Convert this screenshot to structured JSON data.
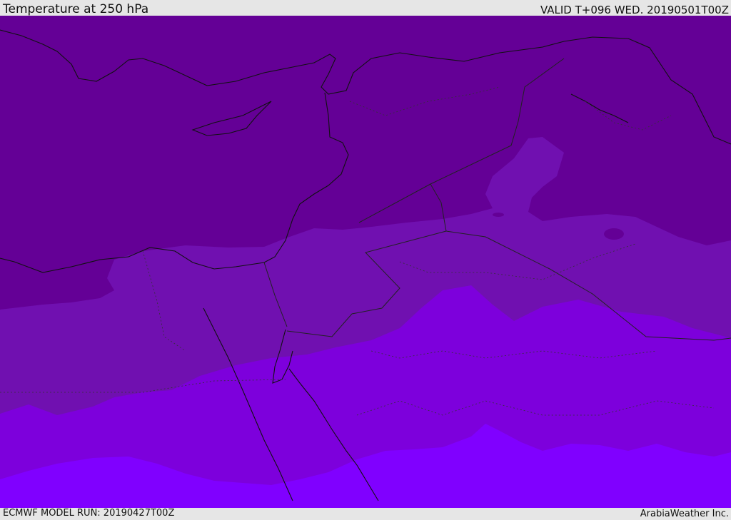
{
  "header": {
    "title": "Temperature at 250 hPa",
    "valid": "VALID T+096 WED. 20190501T00Z"
  },
  "footer": {
    "model_run": "ECMWF MODEL RUN: 20190427T00Z",
    "credit": "ArabiaWeather Inc."
  },
  "colors": {
    "band_coldest": "#640096",
    "band_cold": "#7010b0",
    "band_mid": "#7d00dc",
    "band_warm": "#8000ff",
    "coastline": "#111111",
    "border": "#222222"
  }
}
